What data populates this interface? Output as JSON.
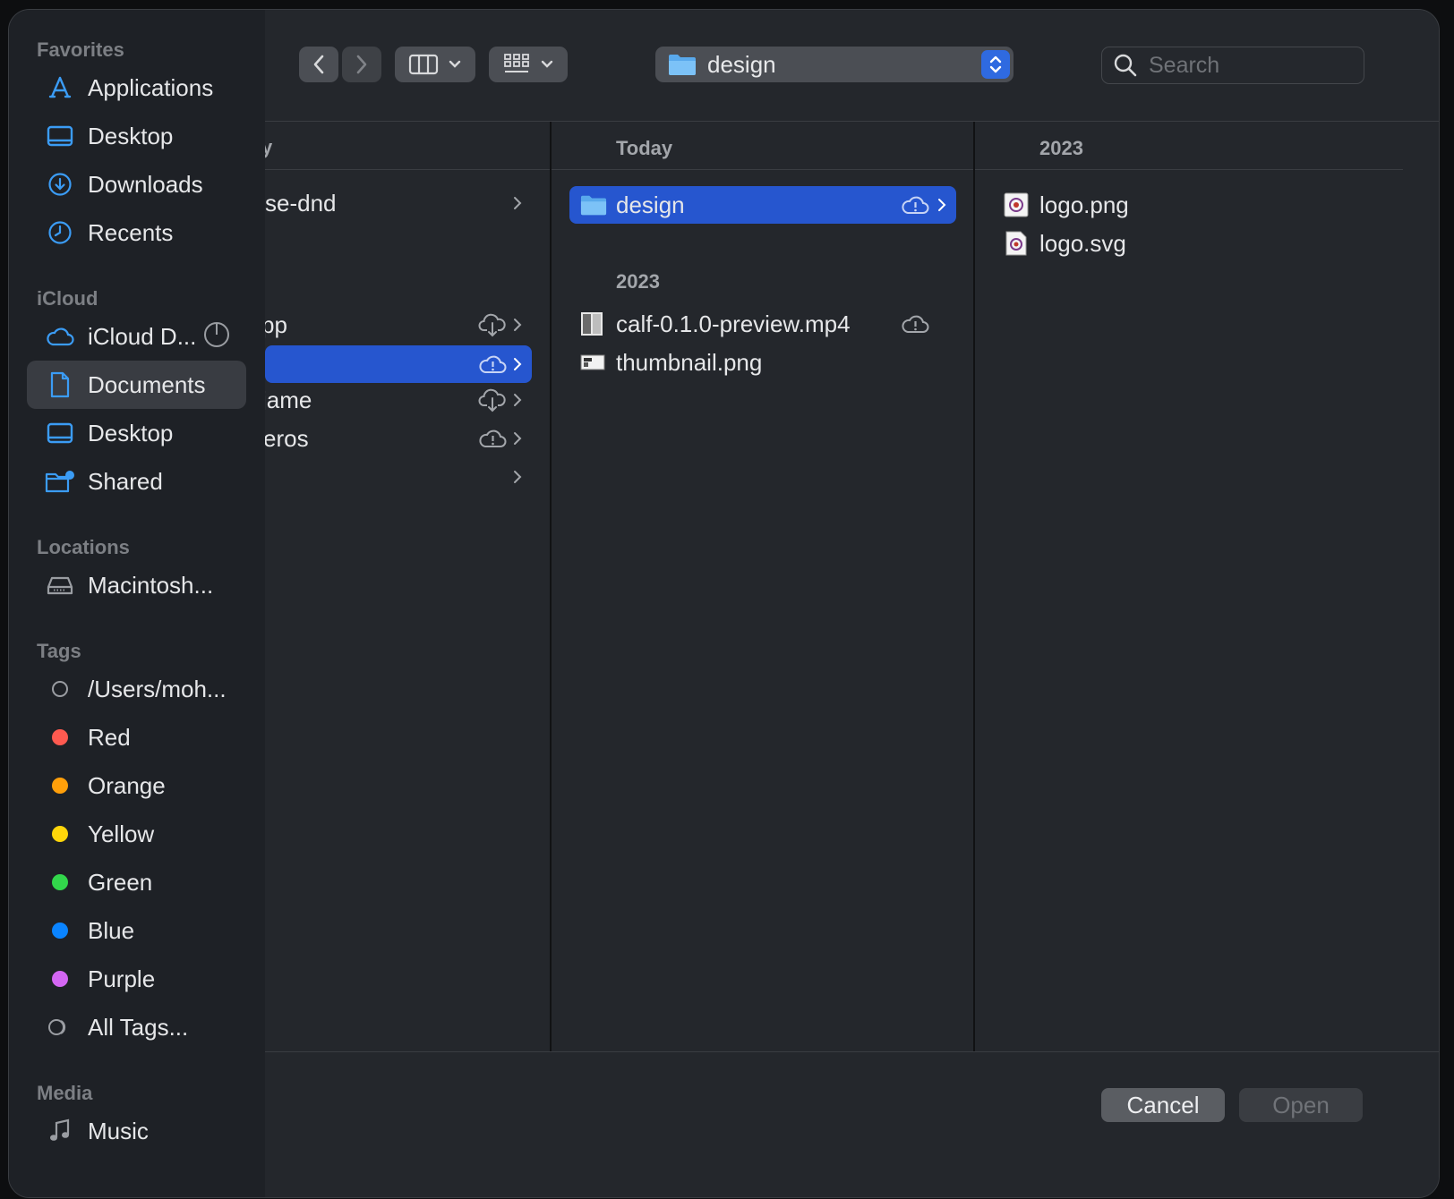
{
  "sidebar": {
    "favorites_header": "Favorites",
    "favorites": [
      {
        "label": "Applications",
        "icon": "applications-icon"
      },
      {
        "label": "Desktop",
        "icon": "desktop-icon"
      },
      {
        "label": "Downloads",
        "icon": "downloads-icon"
      },
      {
        "label": "Recents",
        "icon": "recents-icon"
      }
    ],
    "icloud_header": "iCloud",
    "icloud": [
      {
        "label": "iCloud D...",
        "icon": "icloud-icon"
      },
      {
        "label": "Documents",
        "icon": "document-icon",
        "selected": true
      },
      {
        "label": "Desktop",
        "icon": "desktop-icon"
      },
      {
        "label": "Shared",
        "icon": "shared-folder-icon"
      }
    ],
    "locations_header": "Locations",
    "locations": [
      {
        "label": "Macintosh...",
        "icon": "hard-drive-icon"
      }
    ],
    "tags_header": "Tags",
    "tags": [
      {
        "label": "/Users/moh...",
        "color": ""
      },
      {
        "label": "Red",
        "color": "#ff5a50"
      },
      {
        "label": "Orange",
        "color": "#ff9f0a"
      },
      {
        "label": "Yellow",
        "color": "#ffd60a"
      },
      {
        "label": "Green",
        "color": "#32d74b"
      },
      {
        "label": "Blue",
        "color": "#0a84ff"
      },
      {
        "label": "Purple",
        "color": "#d466f3"
      },
      {
        "label": "All Tags...",
        "color": ""
      }
    ],
    "media_header": "Media",
    "media": [
      {
        "label": "Music",
        "icon": "music-note-icon"
      }
    ]
  },
  "toolbar": {
    "path_label": "design",
    "search_placeholder": "Search"
  },
  "column1": {
    "header": "y",
    "rows": [
      {
        "name": "se-dnd",
        "cloud": "",
        "chevron": true
      },
      {
        "name": "pp",
        "cloud": "download",
        "chevron": true
      },
      {
        "name": "",
        "cloud": "warning",
        "chevron": true,
        "selected": true
      },
      {
        "name": "jame",
        "cloud": "download",
        "chevron": true
      },
      {
        "name": "eros",
        "cloud": "warning",
        "chevron": true
      },
      {
        "name": "",
        "cloud": "",
        "chevron": true
      }
    ]
  },
  "column2": {
    "today_label": "Today",
    "year_label": "2023",
    "today_rows": [
      {
        "name": "design",
        "type": "folder",
        "cloud": "warning",
        "chevron": true,
        "selected": true
      }
    ],
    "year_rows": [
      {
        "name": "calf-0.1.0-preview.mp4",
        "type": "video",
        "cloud": "warning"
      },
      {
        "name": "thumbnail.png",
        "type": "image"
      }
    ]
  },
  "column3": {
    "year_label": "2023",
    "rows": [
      {
        "name": "logo.png",
        "type": "image"
      },
      {
        "name": "logo.svg",
        "type": "image"
      }
    ]
  },
  "footer": {
    "cancel_label": "Cancel",
    "open_label": "Open"
  },
  "colors": {
    "accent": "#2656cf",
    "sidebar_icon": "#3b9cf5",
    "window_bg": "#24272c",
    "sidebar_bg": "#1e2126"
  }
}
